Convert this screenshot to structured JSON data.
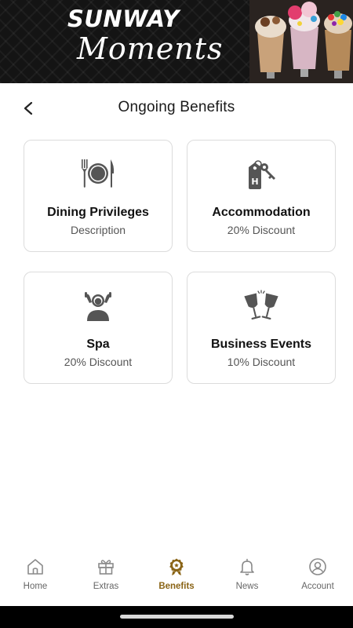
{
  "banner": {
    "brand_top": "SUNWAY",
    "brand_script": "Moments"
  },
  "header": {
    "title": "Ongoing Benefits",
    "back_icon": "chevron-left-icon"
  },
  "benefits": [
    {
      "title": "Dining Privileges",
      "subtitle": "Description",
      "icon": "dining-plate-icon"
    },
    {
      "title": "Accommodation",
      "subtitle": "20% Discount",
      "icon": "hotel-key-icon"
    },
    {
      "title": "Spa",
      "subtitle": "20% Discount",
      "icon": "spa-massage-icon"
    },
    {
      "title": "Business Events",
      "subtitle": "10% Discount",
      "icon": "champagne-glasses-icon"
    }
  ],
  "nav": {
    "items": [
      {
        "label": "Home",
        "icon": "home-icon",
        "active": false
      },
      {
        "label": "Extras",
        "icon": "gift-icon",
        "active": false
      },
      {
        "label": "Benefits",
        "icon": "award-badge-icon",
        "active": true
      },
      {
        "label": "News",
        "icon": "bell-icon",
        "active": false
      },
      {
        "label": "Account",
        "icon": "user-circle-icon",
        "active": false
      }
    ]
  },
  "colors": {
    "accent": "#8a6416",
    "icon_gray": "#555555",
    "nav_inactive": "#8a8a8a",
    "banner_bg": "#141414"
  }
}
